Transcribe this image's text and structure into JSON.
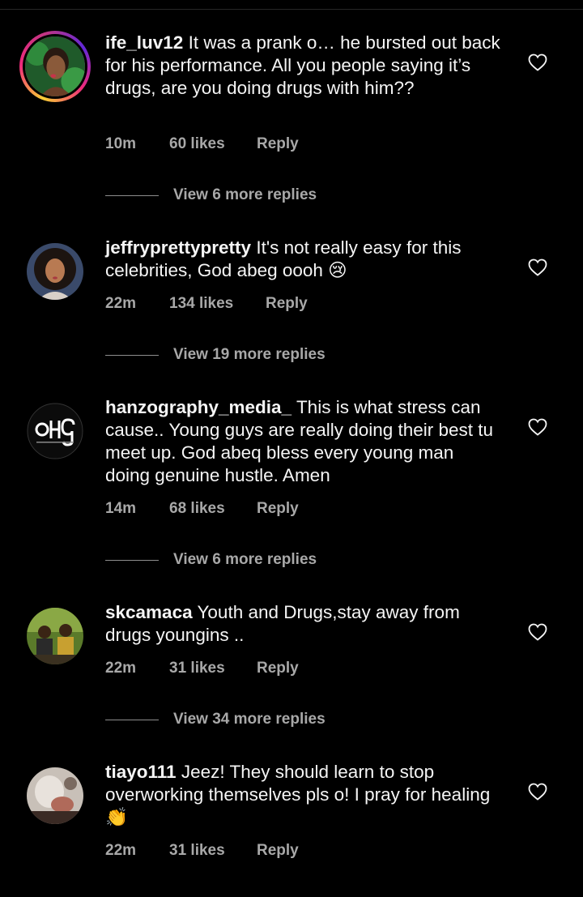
{
  "comments": [
    {
      "username": "ife_luv12",
      "text": "It was a prank o… he bursted out back for his performance. All you people saying it’s drugs, are you doing drugs with him??",
      "time": "10m",
      "likes": "60 likes",
      "reply": "Reply",
      "view_replies": "View 6 more replies",
      "avatar_icon": "profile-photo"
    },
    {
      "username": "jeffryprettypretty",
      "text": "It's not really easy for this celebrities, God abeg oooh 😢",
      "time": "22m",
      "likes": "134 likes",
      "reply": "Reply",
      "view_replies": "View 19 more replies",
      "avatar_icon": "profile-photo"
    },
    {
      "username": "hanzography_media_",
      "text": "This is what stress can cause.. Young guys are really doing their best tu meet up. God abeq bless every young man doing genuine hustle. Amen",
      "time": "14m",
      "likes": "68 likes",
      "reply": "Reply",
      "view_replies": "View 6 more replies",
      "avatar_icon": "logo-avatar"
    },
    {
      "username": "skcamaca",
      "text": "Youth and Drugs,stay away from drugs youngins ..",
      "time": "22m",
      "likes": "31 likes",
      "reply": "Reply",
      "view_replies": "View 34 more replies",
      "avatar_icon": "profile-photo"
    },
    {
      "username": "tiayo111",
      "text": "Jeez! They should learn to stop overworking themselves pls o! I pray for healing 👏",
      "time": "22m",
      "likes": "31 likes",
      "reply": "Reply",
      "avatar_icon": "profile-photo"
    }
  ],
  "icons": {
    "like": "heart-outline-icon"
  },
  "colors": {
    "background": "#000000",
    "text": "#f5f5f5",
    "secondary": "#a8a8a8"
  }
}
